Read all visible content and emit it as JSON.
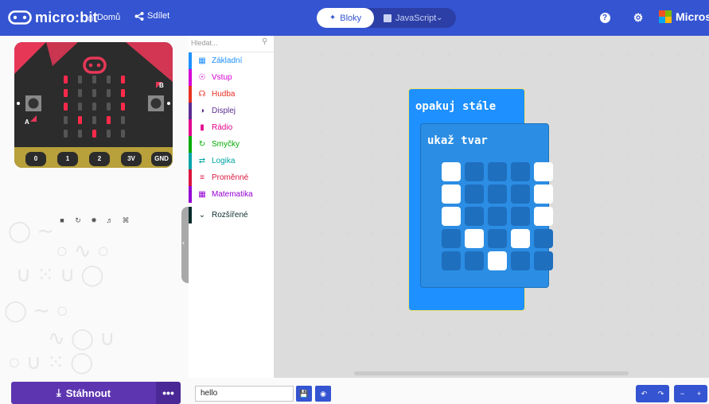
{
  "header": {
    "app_name": "micro:bit",
    "home_label": "Domů",
    "share_label": "Sdílet",
    "blocks_label": "Bloky",
    "javascript_label": "JavaScript",
    "brand_label": "Microsoft",
    "colors": {
      "topbar": "#3454d1",
      "download": "#5e35b1"
    }
  },
  "simulator": {
    "pins": [
      "0",
      "1",
      "2",
      "3V",
      "GND"
    ],
    "button_a": "A",
    "button_b": "B",
    "controls": [
      "stop-icon",
      "restart-icon",
      "slow-motion-icon",
      "mute-icon",
      "fullscreen-icon"
    ]
  },
  "toolbox": {
    "search_placeholder": "Hledat...",
    "categories": [
      {
        "label": "Základní",
        "color": "#1e90ff",
        "icon": "grid-icon"
      },
      {
        "label": "Vstup",
        "color": "#d400d4",
        "icon": "input-icon"
      },
      {
        "label": "Hudba",
        "color": "#e63022",
        "icon": "headphones-icon"
      },
      {
        "label": "Displej",
        "color": "#5c2d91",
        "icon": "toggle-icon"
      },
      {
        "label": "Rádio",
        "color": "#e3008c",
        "icon": "signal-icon"
      },
      {
        "label": "Smyčky",
        "color": "#00aa00",
        "icon": "loop-icon"
      },
      {
        "label": "Logika",
        "color": "#00a4a6",
        "icon": "shuffle-icon"
      },
      {
        "label": "Proměnné",
        "color": "#dc143c",
        "icon": "variables-icon"
      },
      {
        "label": "Matematika",
        "color": "#9400d3",
        "icon": "calculator-icon"
      },
      {
        "label": "Rozšířené",
        "color": "#0b2b2b",
        "icon": "chevron-down-icon"
      }
    ]
  },
  "workspace": {
    "forever_label": "opakuj stále",
    "show_leds_label": "ukaž tvar",
    "leds": [
      [
        1,
        0,
        0,
        0,
        1
      ],
      [
        1,
        0,
        0,
        0,
        1
      ],
      [
        1,
        0,
        0,
        0,
        1
      ],
      [
        0,
        1,
        0,
        1,
        0
      ],
      [
        0,
        0,
        1,
        0,
        0
      ]
    ]
  },
  "footer": {
    "download_label": "Stáhnout",
    "more_label": "•••",
    "project_name": "hello"
  }
}
